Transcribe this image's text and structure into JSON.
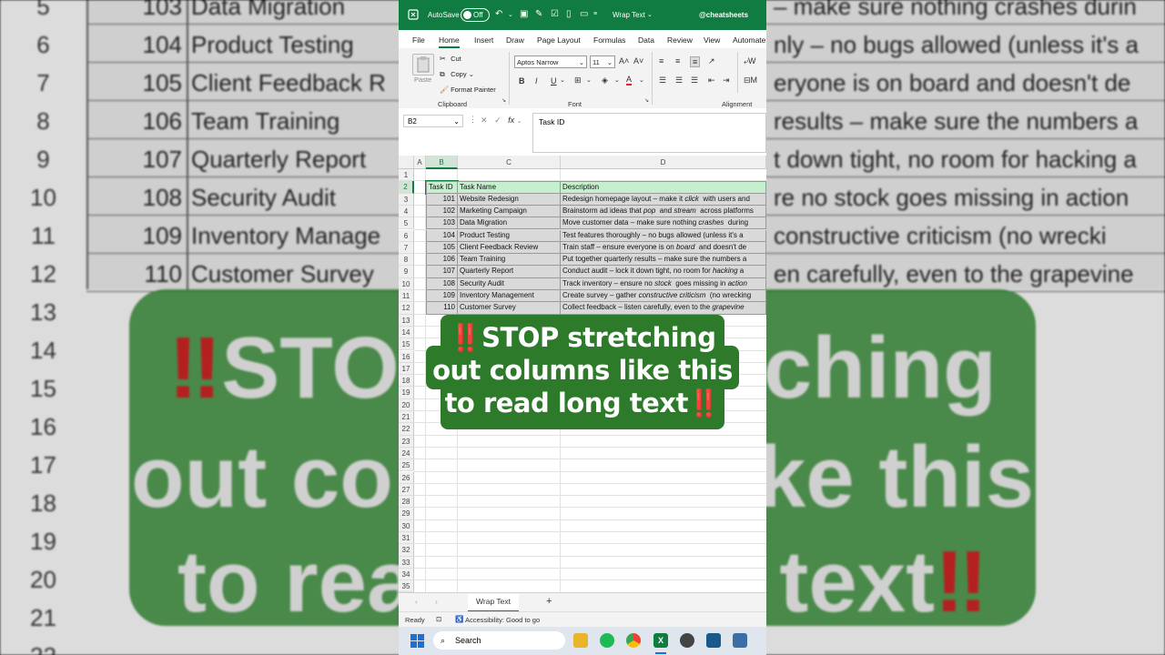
{
  "title_bar": {
    "autosave_label": "AutoSave",
    "autosave_state": "Off",
    "doc_name": "Wrap Text",
    "handle": "@cheatsheets"
  },
  "menu": [
    "File",
    "Home",
    "Insert",
    "Draw",
    "Page Layout",
    "Formulas",
    "Data",
    "Review",
    "View",
    "Automate"
  ],
  "menu_active": "Home",
  "ribbon": {
    "paste": "Paste",
    "cut": "Cut",
    "copy": "Copy",
    "format_painter": "Format Painter",
    "clipboard_group": "Clipboard",
    "font_name": "Aptos Narrow",
    "font_size": "11",
    "font_group": "Font",
    "alignment_group": "Alignment"
  },
  "formula_bar": {
    "name_box": "B2",
    "fx": "fx",
    "value": "Task ID"
  },
  "grid": {
    "columns": [
      "A",
      "B",
      "C",
      "D"
    ],
    "row_numbers": [
      "1",
      "2",
      "3",
      "4",
      "5",
      "6",
      "7",
      "8",
      "9",
      "10",
      "11",
      "12",
      "13",
      "14",
      "15",
      "16",
      "17",
      "18",
      "19",
      "20",
      "21",
      "22",
      "23",
      "24",
      "25",
      "26",
      "27",
      "28",
      "29",
      "30",
      "31",
      "32",
      "33",
      "34",
      "35"
    ],
    "headers": [
      "Task ID",
      "Task Name",
      "Description"
    ],
    "rows": [
      {
        "id": "101",
        "name": "Website Redesign",
        "desc_a": "Redesign homepage layout – make it ",
        "desc_em": "click",
        "desc_b": "  with users and"
      },
      {
        "id": "102",
        "name": "Marketing Campaign",
        "desc_a": "Brainstorm ad ideas that ",
        "desc_em": "pop",
        "desc_b": "  and ",
        "desc_em2": "stream",
        "desc_c": "  across platforms"
      },
      {
        "id": "103",
        "name": "Data Migration",
        "desc_a": "Move customer data – make sure nothing ",
        "desc_em": "crashes",
        "desc_b": "  during"
      },
      {
        "id": "104",
        "name": "Product Testing",
        "desc_a": "Test features thoroughly – no bugs allowed (unless it's a",
        "desc_em": "",
        "desc_b": ""
      },
      {
        "id": "105",
        "name": "Client Feedback Review",
        "desc_a": "Train staff – ensure everyone is on ",
        "desc_em": "board",
        "desc_b": "  and doesn't de"
      },
      {
        "id": "106",
        "name": "Team Training",
        "desc_a": "Put together quarterly results – make sure the numbers a",
        "desc_em": "",
        "desc_b": ""
      },
      {
        "id": "107",
        "name": "Quarterly Report",
        "desc_a": "Conduct audit – lock it down tight, no room for ",
        "desc_em": "hacking",
        "desc_b": " a"
      },
      {
        "id": "108",
        "name": "Security Audit",
        "desc_a": "Track inventory – ensure no ",
        "desc_em": "stock",
        "desc_b": "  goes missing in ",
        "desc_em2": "action",
        "desc_c": ""
      },
      {
        "id": "109",
        "name": "Inventory Management",
        "desc_a": "Create survey – gather ",
        "desc_em": "constructive criticism",
        "desc_b": "  (no wrecking"
      },
      {
        "id": "110",
        "name": "Customer Survey",
        "desc_a": "Collect feedback – listen carefully, even to the ",
        "desc_em": "grapevine",
        "desc_b": ""
      }
    ]
  },
  "sheet_tab": "Wrap Text",
  "status": {
    "ready": "Ready",
    "accessibility": "Accessibility: Good to go"
  },
  "taskbar": {
    "search_placeholder": "Search"
  },
  "overlay": {
    "line1": "STOP stretching",
    "line2": "out columns like this",
    "line3": "to read long text",
    "bang": "‼️"
  },
  "background": {
    "row_numbers": [
      "5",
      "6",
      "7",
      "8",
      "9",
      "10",
      "11",
      "12",
      "13",
      "14",
      "15",
      "16",
      "17",
      "18",
      "19",
      "20",
      "21",
      "22"
    ],
    "ids": [
      "103",
      "104",
      "105",
      "106",
      "107",
      "108",
      "109",
      "110"
    ],
    "names": [
      "Data Migration",
      "Product Testing",
      "Client Feedback R",
      "Team Training",
      "Quarterly Report",
      "Security Audit",
      "Inventory Manage",
      "Customer Survey"
    ],
    "descs": [
      "– make sure nothing crashes durin",
      "nly – no bugs allowed (unless it's a",
      "eryone is on board  and doesn't de",
      "results – make sure the numbers a",
      "t down tight, no room for hacking a",
      "re no stock  goes missing in action",
      "constructive criticism  (no wrecki",
      "en carefully, even to the grapevine"
    ],
    "big1": "‼STO        ching",
    "big2": "out co          ke this",
    "big3": "to rea           text‼"
  },
  "colors": {
    "excel_green": "#107c41",
    "header_fill": "#c6efce",
    "body_fill": "#d9d9d9",
    "banner_green": "#2d7a2a",
    "alert_red": "#e8231f"
  }
}
